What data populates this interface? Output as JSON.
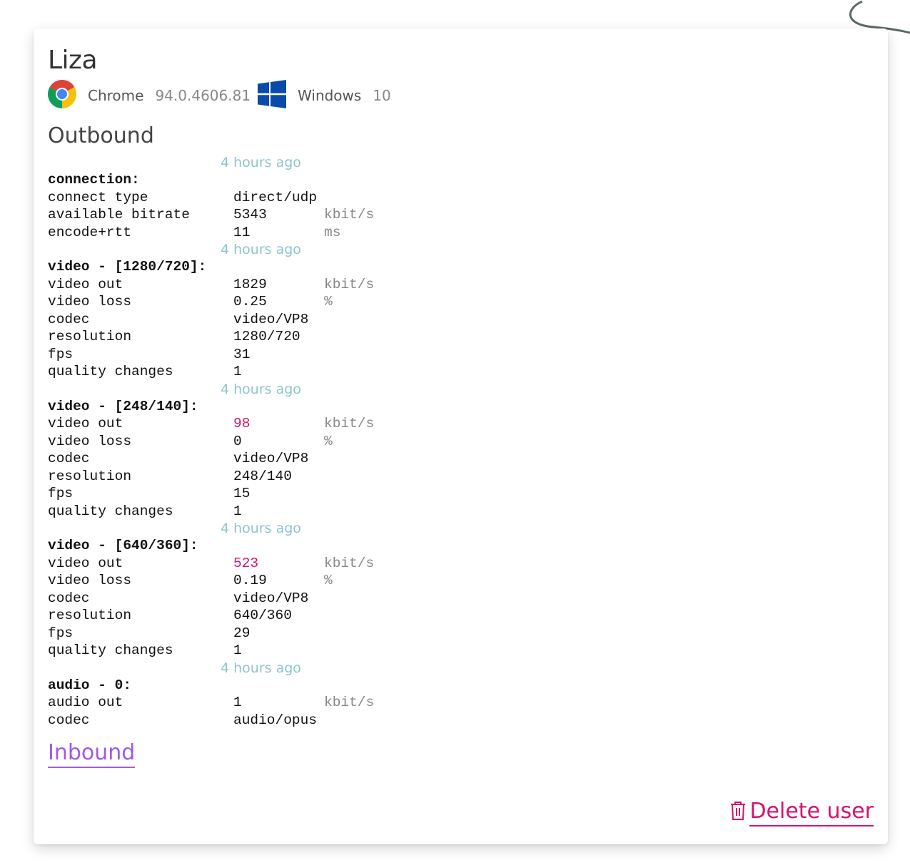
{
  "user": {
    "name": "Liza"
  },
  "client": {
    "browser_icon": "chrome-icon",
    "browser": "Chrome",
    "browser_version": "94.0.4606.81",
    "os_icon": "windows-icon",
    "os": "Windows",
    "os_version": "10"
  },
  "outbound": {
    "title": "Outbound",
    "sections": [
      {
        "timestamp": "4 hours ago",
        "header": "connection:",
        "rows": [
          {
            "key": "connect type",
            "value": "direct/udp",
            "unit": ""
          },
          {
            "key": "available bitrate",
            "value": "5343",
            "unit": "kbit/s"
          },
          {
            "key": "encode+rtt",
            "value": "11",
            "unit": "ms"
          }
        ]
      },
      {
        "timestamp": "4 hours ago",
        "header": "video - [1280/720]:",
        "rows": [
          {
            "key": "video out",
            "value": "1829",
            "unit": "kbit/s"
          },
          {
            "key": "video loss",
            "value": "0.25",
            "unit": "%"
          },
          {
            "key": "codec",
            "value": "video/VP8",
            "unit": ""
          },
          {
            "key": "resolution",
            "value": "1280/720",
            "unit": ""
          },
          {
            "key": "fps",
            "value": "31",
            "unit": ""
          },
          {
            "key": "quality changes",
            "value": "1",
            "unit": ""
          }
        ]
      },
      {
        "timestamp": "4 hours ago",
        "header": "video - [248/140]:",
        "rows": [
          {
            "key": "video out",
            "value": "98",
            "unit": "kbit/s",
            "highlight": true
          },
          {
            "key": "video loss",
            "value": "0",
            "unit": "%"
          },
          {
            "key": "codec",
            "value": "video/VP8",
            "unit": ""
          },
          {
            "key": "resolution",
            "value": "248/140",
            "unit": ""
          },
          {
            "key": "fps",
            "value": "15",
            "unit": ""
          },
          {
            "key": "quality changes",
            "value": "1",
            "unit": ""
          }
        ]
      },
      {
        "timestamp": "4 hours ago",
        "header": "video - [640/360]:",
        "rows": [
          {
            "key": "video out",
            "value": "523",
            "unit": "kbit/s",
            "highlight": true
          },
          {
            "key": "video loss",
            "value": "0.19",
            "unit": "%"
          },
          {
            "key": "codec",
            "value": "video/VP8",
            "unit": ""
          },
          {
            "key": "resolution",
            "value": "640/360",
            "unit": ""
          },
          {
            "key": "fps",
            "value": "29",
            "unit": ""
          },
          {
            "key": "quality changes",
            "value": "1",
            "unit": ""
          }
        ]
      },
      {
        "timestamp": "4 hours ago",
        "header": "audio - 0:",
        "rows": [
          {
            "key": "audio out",
            "value": "1",
            "unit": "kbit/s"
          },
          {
            "key": "codec",
            "value": "audio/opus",
            "unit": ""
          }
        ]
      }
    ]
  },
  "inbound": {
    "label": "Inbound"
  },
  "actions": {
    "delete_icon": "trash-icon",
    "delete_label": "Delete user"
  },
  "colors": {
    "accent_pink": "#d6136a",
    "accent_purple": "#a259e6",
    "timestamp": "#8cc5d2",
    "unit": "#888888"
  }
}
